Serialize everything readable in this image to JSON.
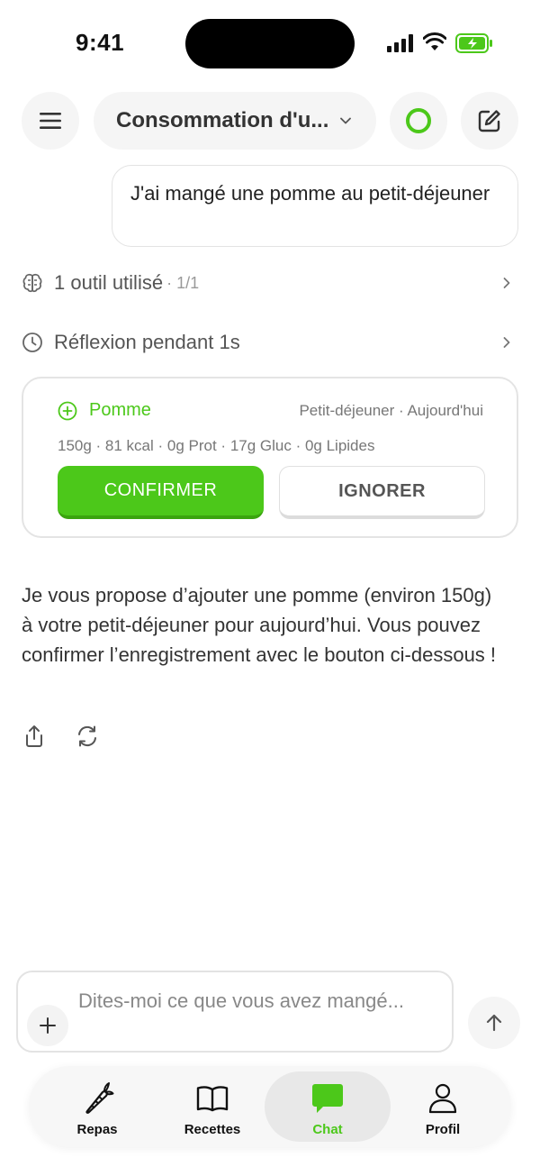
{
  "status_bar": {
    "time": "9:41"
  },
  "header": {
    "title": "Consommation d'u...",
    "menu_icon": "hamburger-icon",
    "status_icon": "status-ring-icon",
    "edit_icon": "compose-icon",
    "accent": "#4cc81a"
  },
  "conversation": {
    "user_message": "J'ai mangé une pomme au petit-déjeuner",
    "tools": {
      "label": "1 outil utilisé",
      "count": "· 1/1"
    },
    "thinking": {
      "label": "Réflexion pendant 1s"
    },
    "suggestion": {
      "food": "Pomme",
      "meal": "Petit-déjeuner · Aujourd'hui",
      "macros": "150g · 81 kcal · 0g Prot · 17g Gluc · 0g Lipides",
      "confirm_label": "CONFIRMER",
      "ignore_label": "IGNORER"
    },
    "assistant_message": "Je vous propose d’ajouter une pomme (environ 150g) à votre petit-déjeuner pour aujourd’hui. Vous pouvez confirmer l’enregistrement avec le bouton ci-dessous !"
  },
  "composer": {
    "placeholder": "Dites-moi ce que vous avez mangé..."
  },
  "tabbar": {
    "items": [
      {
        "label": "Repas",
        "icon": "carrot-icon"
      },
      {
        "label": "Recettes",
        "icon": "book-icon"
      },
      {
        "label": "Chat",
        "icon": "chat-bubble-icon",
        "active": true
      },
      {
        "label": "Profil",
        "icon": "user-icon"
      }
    ]
  }
}
